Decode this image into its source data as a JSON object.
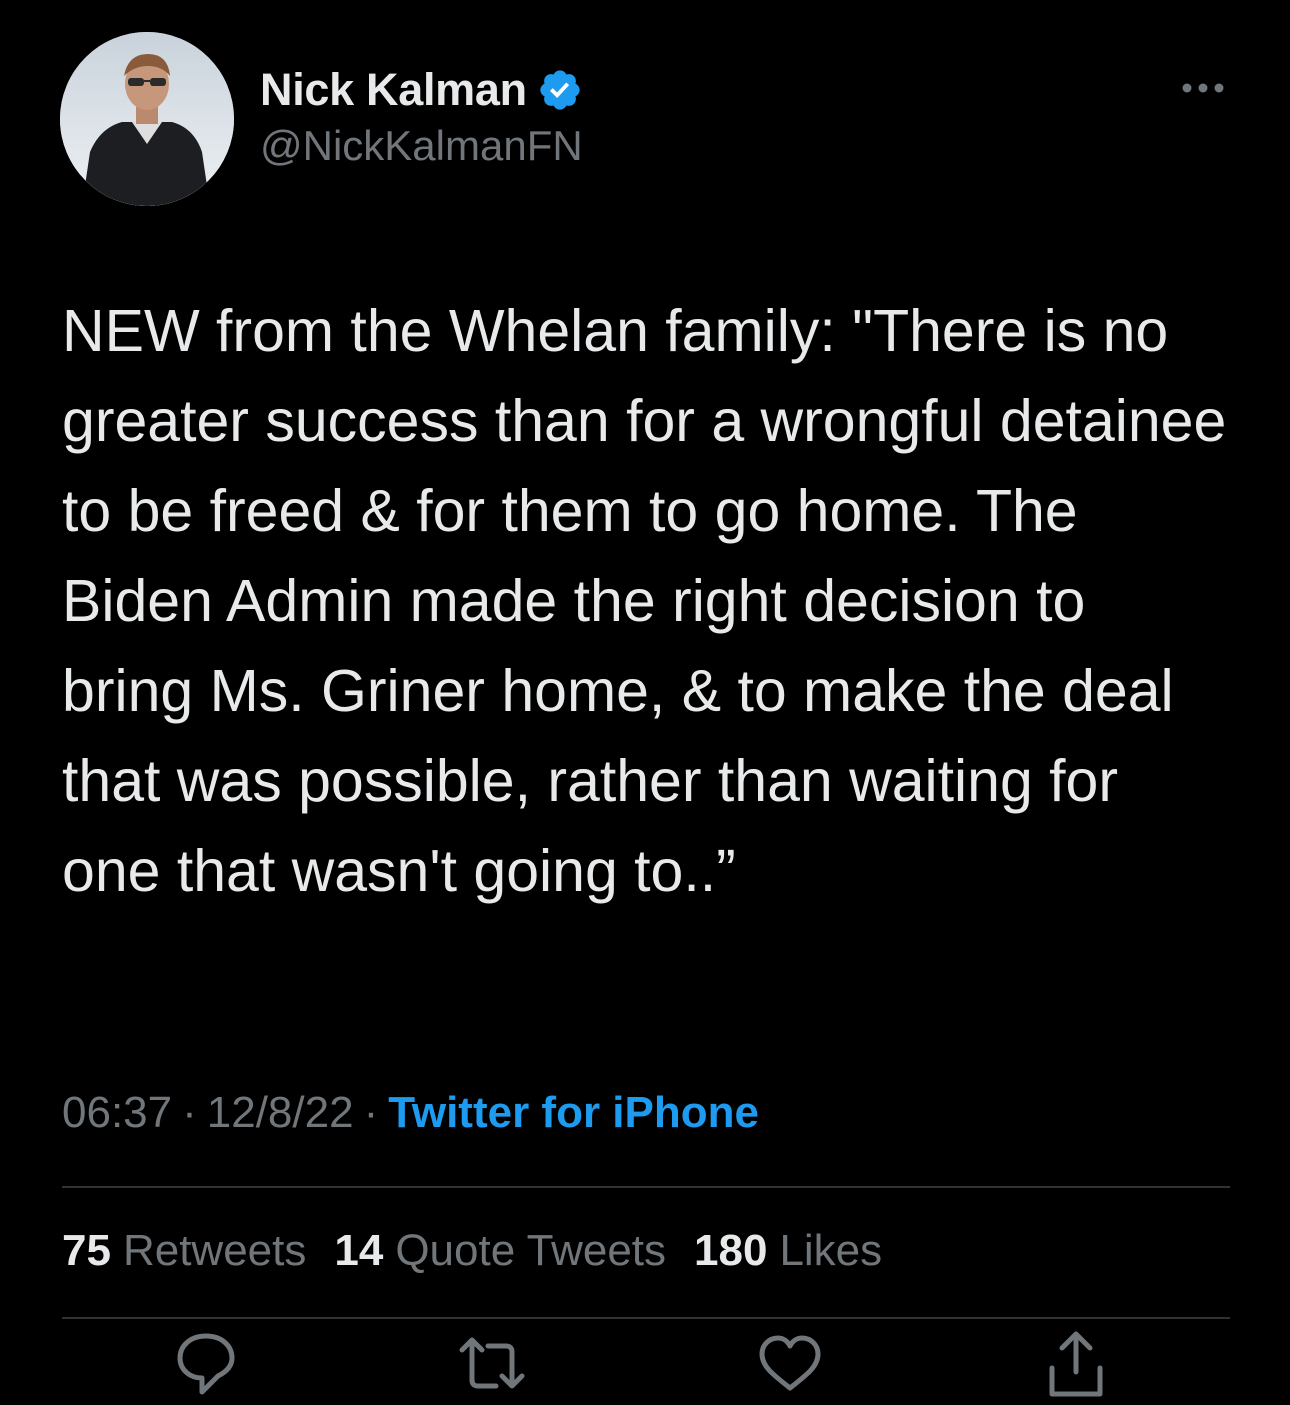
{
  "author": {
    "name": "Nick Kalman",
    "handle": "@NickKalmanFN",
    "verified": true
  },
  "tweet": {
    "text": "NEW from the Whelan family: \"There is no greater success than for a wrongful detainee to be freed & for them to go home. The Biden Admin made the right decision to bring Ms. Griner home, & to make the deal that was possible, rather than waiting for one that wasn't going to..”",
    "time": "06:37",
    "date": "12/8/22",
    "separator": "·",
    "source": "Twitter for iPhone"
  },
  "stats": {
    "retweets_count": "75",
    "retweets_label": "Retweets",
    "quotes_count": "14",
    "quotes_label": "Quote Tweets",
    "likes_count": "180",
    "likes_label": "Likes"
  },
  "actions": [
    "reply-icon",
    "retweet-icon",
    "like-icon",
    "share-icon"
  ],
  "colors": {
    "background": "#000000",
    "primary_text": "#e7e9ea",
    "secondary_text": "#71767b",
    "accent": "#1d9bf0",
    "divider": "#2f3336"
  }
}
